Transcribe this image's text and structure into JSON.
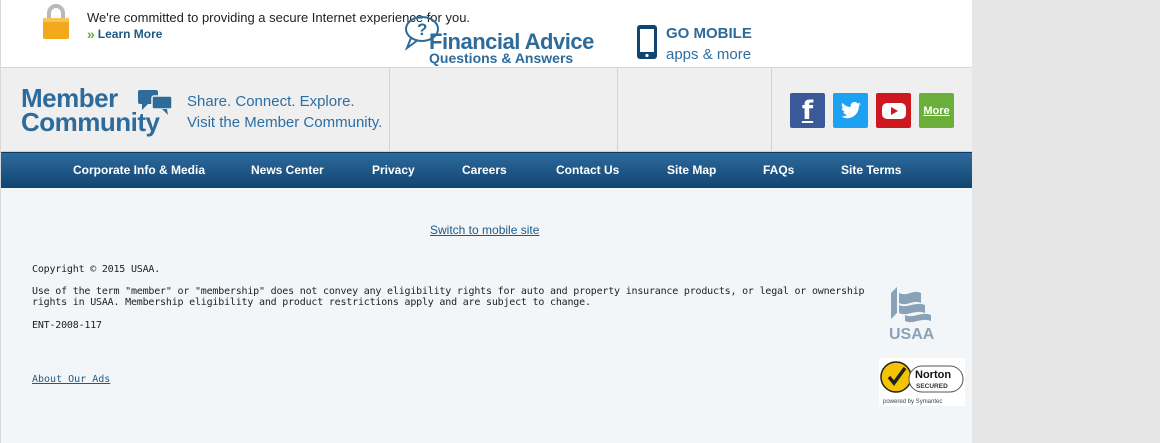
{
  "security_notice": {
    "text": "We're committed to providing a secure Internet experience for you.",
    "learn_more": "Learn More",
    "learn_more_prefix": "»"
  },
  "promo": {
    "member_community": {
      "logo_line1": "Member",
      "logo_line2": "Community",
      "tagline1": "Share. Connect. Explore.",
      "tagline2": "Visit the Member Community."
    },
    "financial_advice": {
      "title": "Financial Advice",
      "subtitle": "Questions & Answers",
      "icon_glyph": "?"
    },
    "go_mobile": {
      "title": "GO MOBILE",
      "subtitle": "apps & more"
    },
    "social": {
      "facebook_glyph": "f",
      "more_label": "More"
    }
  },
  "nav": {
    "items": [
      "Corporate Info & Media",
      "News Center",
      "Privacy",
      "Careers",
      "Contact Us",
      "Site Map",
      "FAQs",
      "Site Terms"
    ]
  },
  "footer": {
    "switch_mobile": "Switch to mobile site",
    "copyright": "Copyright © 2015 USAA.",
    "legal": "Use of the term \"member\" or \"membership\" does not convey any eligibility rights for auto and property insurance products, or legal or ownership rights in USAA. Membership eligibility and product restrictions apply and are subject to change.",
    "code": "ENT-2008-117",
    "about_ads": "About Our Ads",
    "usaa_logo_text": "USAA",
    "norton": {
      "line1": "Norton",
      "line2": "SECURED",
      "powered": "powered by Symantec"
    }
  },
  "colors": {
    "brand_blue": "#2d6b9b",
    "nav_top": "#2e6a9d",
    "nav_bottom": "#114571",
    "facebook": "#3b5998",
    "twitter": "#1da1f2",
    "youtube": "#cc181e",
    "more": "#6aaf3a",
    "lock": "#f2a91b"
  }
}
